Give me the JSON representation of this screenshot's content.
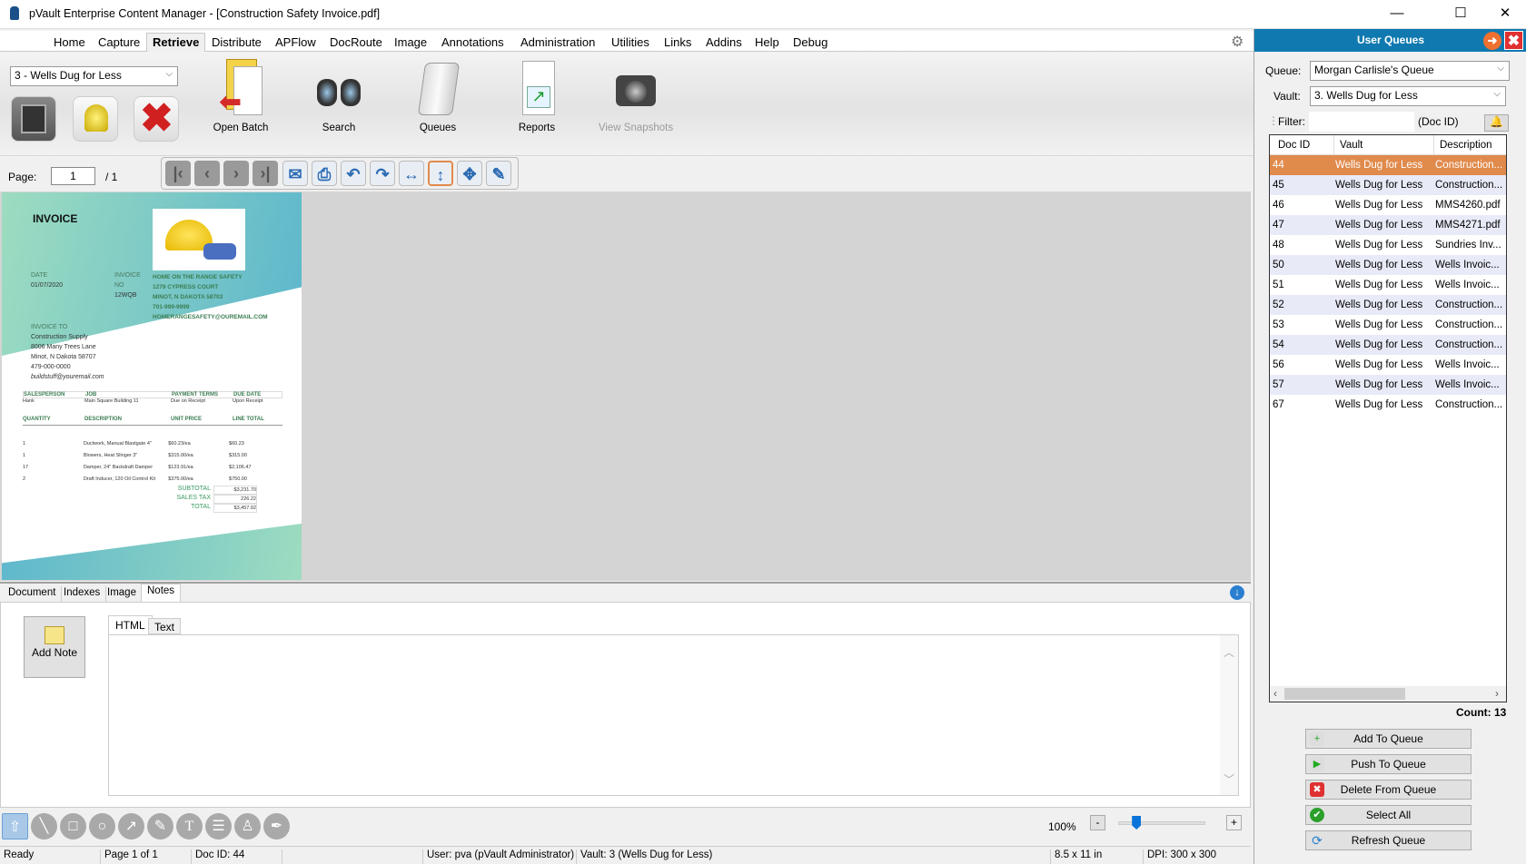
{
  "window": {
    "title": "pVault Enterprise Content Manager - [Construction Safety Invoice.pdf]",
    "minimize": "—",
    "maximize": "☐",
    "close": "✕"
  },
  "menu": [
    {
      "label": "Home"
    },
    {
      "label": "Capture"
    },
    {
      "label": "Retrieve",
      "active": true
    },
    {
      "label": "Distribute"
    },
    {
      "label": "APFlow"
    },
    {
      "label": "DocRoute"
    },
    {
      "label": "Image"
    },
    {
      "label": "Annotations"
    },
    {
      "label": "Administration"
    },
    {
      "label": "Utilities"
    },
    {
      "label": "Links"
    },
    {
      "label": "Addins"
    },
    {
      "label": "Help"
    },
    {
      "label": "Debug"
    }
  ],
  "ribbon": {
    "vault_select": "3 - Wells Dug for Less",
    "buttons": [
      {
        "label": "Open Batch",
        "icon": "open-batch-icon"
      },
      {
        "label": "Search",
        "icon": "binoculars-icon"
      },
      {
        "label": "Queues",
        "icon": "scroll-icon"
      },
      {
        "label": "Reports",
        "icon": "report-chart-icon"
      },
      {
        "label": "View Snapshots",
        "icon": "camera-icon",
        "disabled": true
      }
    ]
  },
  "pagebar": {
    "label": "Page:",
    "value": "1",
    "total": "/ 1"
  },
  "invoice": {
    "title": "INVOICE",
    "date_label": "DATE",
    "date": "01/07/2020",
    "invno_label1": "INVOICE",
    "invno_label2": "NO",
    "invno": "12WQB",
    "from": [
      "HOME ON THE RANGE SAFETY",
      "1279 CYPRESS COURT",
      "MINOT, N DAKOTA 58703",
      "701-999-9999",
      "HOMERANGESAFETY@OUREMAIL.COM"
    ],
    "to_label": "INVOICE TO",
    "to": [
      "Construction Supply",
      "8006 Many Trees Lane",
      "Minot, N Dakota 58707",
      "479-000-0000"
    ],
    "to_email": "buildstuff@youremail.com",
    "meta_headers": [
      "SALESPERSON",
      "JOB",
      "PAYMENT TERMS",
      "DUE DATE"
    ],
    "meta_values": [
      "Hank",
      "Main Square Building 11",
      "Due on Receipt",
      "Upon Receipt"
    ],
    "item_headers": [
      "QUANTITY",
      "DESCRIPTION",
      "UNIT PRICE",
      "LINE TOTAL"
    ],
    "items": [
      [
        "1",
        "Ductwork, Manual Blastgate 4\"",
        "$60.23/ea",
        "$60.23"
      ],
      [
        "1",
        "Blowers, Heat Slinger 3\"",
        "$315.00/ea",
        "$315.00"
      ],
      [
        "17",
        "Damper, 24\" Backdraft Damper",
        "$123.91/ea",
        "$2,106.47"
      ],
      [
        "2",
        "Draft Inducer, 120 Oil Control Kit",
        "$375.00/ea",
        "$750.00"
      ]
    ],
    "totals": [
      [
        "SUBTOTAL",
        "$3,231.70"
      ],
      [
        "SALES TAX",
        "226.22"
      ],
      [
        "TOTAL",
        "$3,457.92"
      ]
    ]
  },
  "bottom_tabs": [
    {
      "label": "Document"
    },
    {
      "label": "Indexes"
    },
    {
      "label": "Image"
    },
    {
      "label": "Notes",
      "active": true
    }
  ],
  "notes": {
    "add_note": "Add Note",
    "tabs": [
      {
        "label": "HTML",
        "active": true
      },
      {
        "label": "Text"
      }
    ]
  },
  "zoom": {
    "level": "100%",
    "minus": "-",
    "plus": "+",
    "slider_percent": 20
  },
  "status": {
    "ready": "Ready",
    "page": "Page 1 of 1",
    "doc_id": "Doc ID: 44",
    "user": "User: pva (pVault Administrator)",
    "vault": "Vault: 3 (Wells Dug for Less)",
    "size": "8.5 x 11 in",
    "dpi": "DPI: 300 x 300"
  },
  "queues": {
    "title": "User Queues",
    "queue_label": "Queue:",
    "queue_value": "Morgan Carlisle's Queue",
    "vault_label": "Vault:",
    "vault_value": "3. Wells Dug for Less",
    "filter_label": "Filter:",
    "filter_value": "",
    "filter_hint": "(Doc ID)",
    "columns": [
      "Doc ID",
      "Vault",
      "Description"
    ],
    "rows": [
      [
        "44",
        "Wells Dug for Less",
        "Construction..."
      ],
      [
        "45",
        "Wells Dug for Less",
        "Construction..."
      ],
      [
        "46",
        "Wells Dug for Less",
        "MMS4260.pdf"
      ],
      [
        "47",
        "Wells Dug for Less",
        "MMS4271.pdf"
      ],
      [
        "48",
        "Wells Dug for Less",
        "Sundries Inv..."
      ],
      [
        "50",
        "Wells Dug for Less",
        "Wells Invoic..."
      ],
      [
        "51",
        "Wells Dug for Less",
        "Wells Invoic..."
      ],
      [
        "52",
        "Wells Dug for Less",
        "Construction..."
      ],
      [
        "53",
        "Wells Dug for Less",
        "Construction..."
      ],
      [
        "54",
        "Wells Dug for Less",
        "Construction..."
      ],
      [
        "56",
        "Wells Dug for Less",
        "Wells Invoic..."
      ],
      [
        "57",
        "Wells Dug for Less",
        "Wells Invoic..."
      ],
      [
        "67",
        "Wells Dug for Less",
        "Construction..."
      ]
    ],
    "selected_row": 0,
    "count": "Count: 13",
    "buttons": [
      {
        "label": "Add To Queue",
        "icon": "add-queue-icon"
      },
      {
        "label": "Push To Queue",
        "icon": "push-queue-icon"
      },
      {
        "label": "Delete From Queue",
        "icon": "delete-icon"
      },
      {
        "label": "Select All",
        "icon": "check-icon"
      },
      {
        "label": "Refresh Queue",
        "icon": "refresh-icon"
      }
    ]
  },
  "colors": {
    "accent": "#0f79b0",
    "selected_row": "#e08a4c",
    "alt_row": "#e8eaf8",
    "invoice_green": "#3a7d50"
  }
}
